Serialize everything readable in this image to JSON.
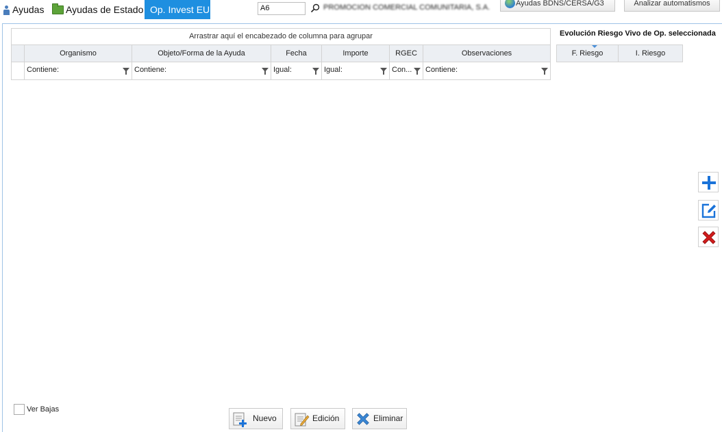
{
  "tabs": [
    {
      "label": "Ayudas",
      "icon": "person-icon"
    },
    {
      "label": "Ayudas de Estado",
      "icon": "folder-icon"
    },
    {
      "label": "Op. Invest EU",
      "active": true
    }
  ],
  "toolbar": {
    "code_value": "A6",
    "company_name": "PROMOCION COMERCIAL COMUNITARIA, S.A.",
    "bdns_label": "Ayudas BDNS/CERSA/G3",
    "analizar_label": "Analizar automatismos"
  },
  "grid": {
    "group_hint": "Arrastrar aquí el encabezado de columna para agrupar",
    "columns": [
      "Organismo",
      "Objeto/Forma de la Ayuda",
      "Fecha",
      "Importe",
      "RGEC",
      "Observaciones"
    ],
    "filters": [
      "Contiene:",
      "Contiene:",
      "Igual:",
      "Igual:",
      "Con...",
      "Contiene:"
    ]
  },
  "evolucion": {
    "title": "Evolución Riesgo Vivo de Op. seleccionada",
    "columns": [
      "F. Riesgo",
      "I. Riesgo"
    ]
  },
  "bottom": {
    "ver_bajas_label": "Ver Bajas",
    "ver_bajas_checked": false,
    "nuevo_label": "Nuevo",
    "edicion_label": "Edición",
    "eliminar_label": "Eliminar"
  },
  "colors": {
    "active_tab": "#1e8fe0",
    "add_icon": "#1a73d9",
    "delete_icon": "#d01c1c"
  }
}
